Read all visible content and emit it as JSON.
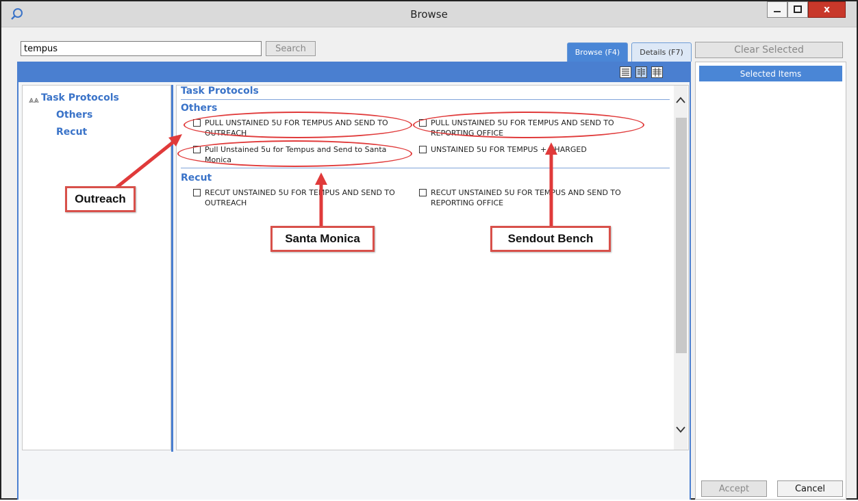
{
  "window": {
    "title": "Browse",
    "close_glyph": "x"
  },
  "search": {
    "value": "tempus",
    "button_label": "Search"
  },
  "tabs": [
    {
      "label": "Browse (F4)",
      "active": true
    },
    {
      "label": "Details (F7)",
      "active": false
    }
  ],
  "tree": {
    "root": "Task Protocols",
    "children": [
      "Others",
      "Recut"
    ]
  },
  "main": {
    "title": "Task Protocols",
    "sections": [
      {
        "heading": "Others",
        "items": [
          {
            "line1": "PULL UNSTAINED 5U FOR TEMPUS AND SEND TO",
            "line2": "OUTREACH"
          },
          {
            "line1": "PULL UNSTAINED 5U FOR TEMPUS AND SEND TO",
            "line2": "REPORTING OFFICE"
          },
          {
            "line1": "Pull Unstained 5u for Tempus and Send to Santa",
            "line2": "Monica"
          },
          {
            "line1": "UNSTAINED 5U FOR TEMPUS + CHARGED",
            "line2": ""
          }
        ]
      },
      {
        "heading": "Recut",
        "items": [
          {
            "line1": "RECUT UNSTAINED 5U FOR TEMPUS AND SEND TO",
            "line2": "OUTREACH"
          },
          {
            "line1": "RECUT UNSTAINED 5U FOR TEMPUS AND SEND TO",
            "line2": "REPORTING OFFICE"
          }
        ]
      }
    ]
  },
  "right": {
    "clear_label": "Clear Selected",
    "selected_header": "Selected Items",
    "accept_label": "Accept",
    "cancel_label": "Cancel"
  },
  "annotations": {
    "outreach": "Outreach",
    "santa_monica": "Santa Monica",
    "sendout_bench": "Sendout Bench",
    "color": "#e03a3a"
  },
  "colors": {
    "accent_blue": "#4a7fd0",
    "link_blue": "#3a73c8"
  }
}
